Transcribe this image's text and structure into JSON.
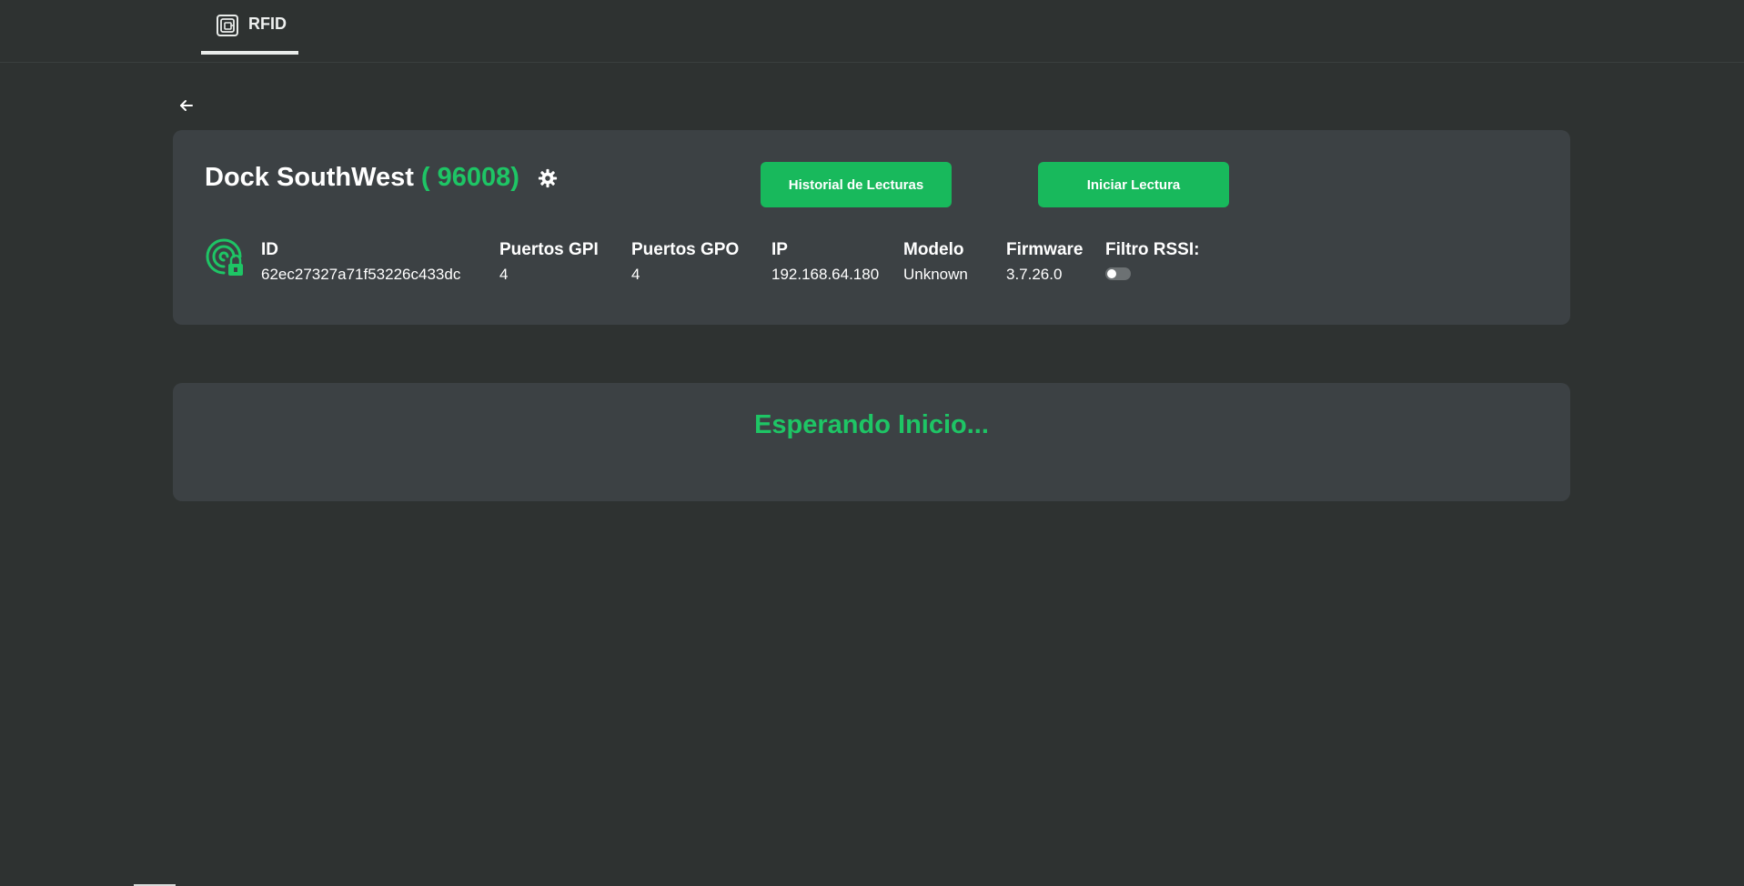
{
  "nav": {
    "tab_label": "RFID",
    "tab_icon": "rfid-chip-icon"
  },
  "back_icon": "arrow-left-icon",
  "reader": {
    "name": "Dock SouthWest",
    "code": "( 96008)",
    "settings_icon": "gear-icon",
    "status_icon": "rfid-reader-lock-icon",
    "buttons": {
      "history": "Historial de Lecturas",
      "start": "Iniciar Lectura"
    },
    "fields": {
      "id": {
        "label": "ID",
        "value": "62ec27327a71f53226c433dc"
      },
      "gpi": {
        "label": "Puertos GPI",
        "value": "4"
      },
      "gpo": {
        "label": "Puertos GPO",
        "value": "4"
      },
      "ip": {
        "label": "IP",
        "value": "192.168.64.180"
      },
      "model": {
        "label": "Modelo",
        "value": "Unknown"
      },
      "firmware": {
        "label": "Firmware",
        "value": "3.7.26.0"
      },
      "rssi": {
        "label": "Filtro RSSI:",
        "enabled": false
      }
    }
  },
  "status": {
    "message": "Esperando Inicio..."
  },
  "colors": {
    "background": "#2e3231",
    "card": "#3c4144",
    "accent": "#1ec565",
    "button": "#18b95c"
  }
}
